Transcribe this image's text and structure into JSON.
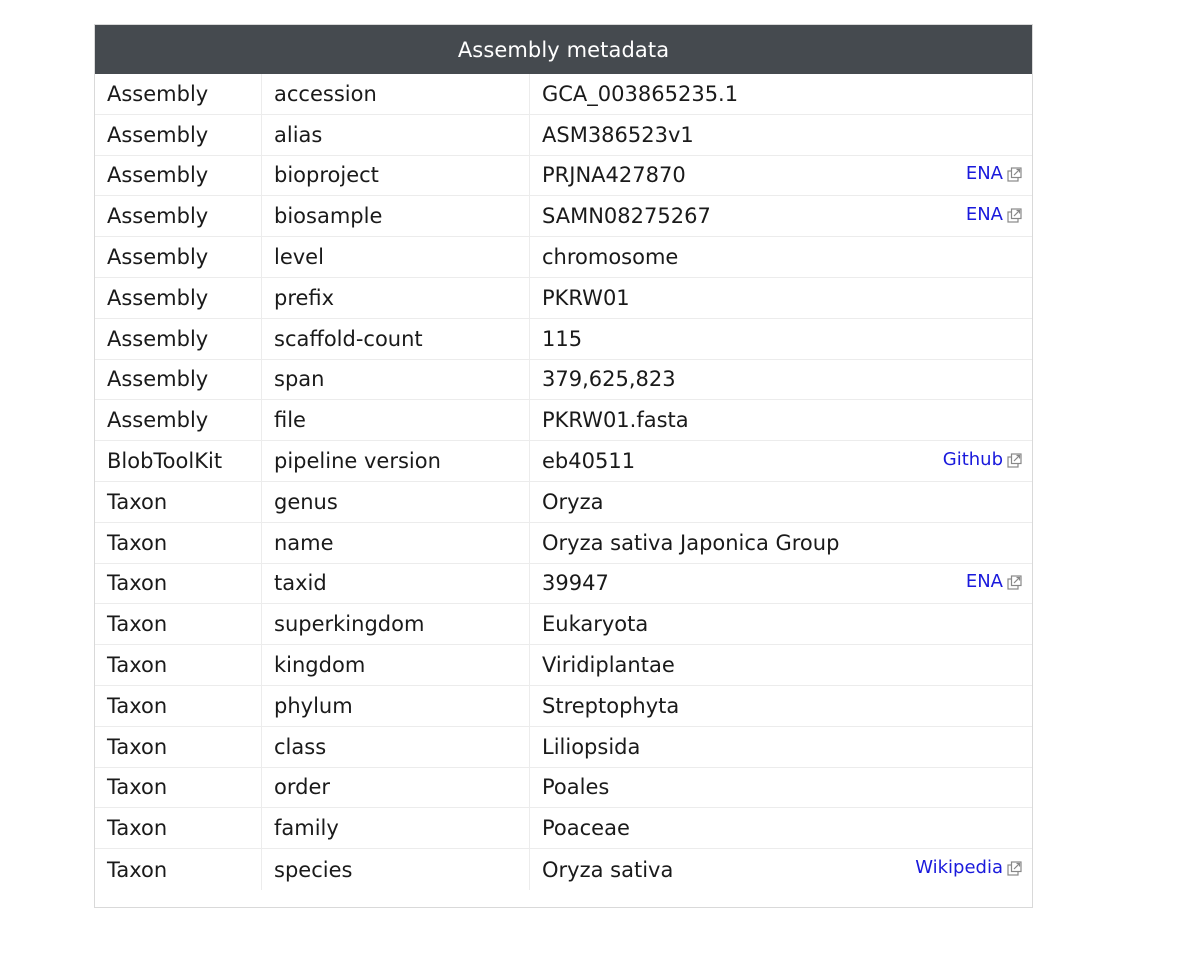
{
  "panel": {
    "title": "Assembly metadata"
  },
  "rows": [
    {
      "group": "Assembly",
      "key": "accession",
      "value": "GCA_003865235.1",
      "link": ""
    },
    {
      "group": "Assembly",
      "key": "alias",
      "value": "ASM386523v1",
      "link": ""
    },
    {
      "group": "Assembly",
      "key": "bioproject",
      "value": "PRJNA427870",
      "link": "ENA"
    },
    {
      "group": "Assembly",
      "key": "biosample",
      "value": "SAMN08275267",
      "link": "ENA"
    },
    {
      "group": "Assembly",
      "key": "level",
      "value": "chromosome",
      "link": ""
    },
    {
      "group": "Assembly",
      "key": "prefix",
      "value": "PKRW01",
      "link": ""
    },
    {
      "group": "Assembly",
      "key": "scaffold-count",
      "value": "115",
      "link": ""
    },
    {
      "group": "Assembly",
      "key": "span",
      "value": "379,625,823",
      "link": ""
    },
    {
      "group": "Assembly",
      "key": "file",
      "value": "PKRW01.fasta",
      "link": ""
    },
    {
      "group": "BlobToolKit",
      "key": "pipeline version",
      "value": "eb40511",
      "link": "Github"
    },
    {
      "group": "Taxon",
      "key": "genus",
      "value": "Oryza",
      "link": ""
    },
    {
      "group": "Taxon",
      "key": "name",
      "value": "Oryza sativa Japonica Group",
      "link": ""
    },
    {
      "group": "Taxon",
      "key": "taxid",
      "value": "39947",
      "link": "ENA"
    },
    {
      "group": "Taxon",
      "key": "superkingdom",
      "value": "Eukaryota",
      "link": ""
    },
    {
      "group": "Taxon",
      "key": "kingdom",
      "value": "Viridiplantae",
      "link": ""
    },
    {
      "group": "Taxon",
      "key": "phylum",
      "value": "Streptophyta",
      "link": ""
    },
    {
      "group": "Taxon",
      "key": "class",
      "value": "Liliopsida",
      "link": ""
    },
    {
      "group": "Taxon",
      "key": "order",
      "value": "Poales",
      "link": ""
    },
    {
      "group": "Taxon",
      "key": "family",
      "value": "Poaceae",
      "link": ""
    },
    {
      "group": "Taxon",
      "key": "species",
      "value": "Oryza sativa",
      "link": "Wikipedia"
    }
  ],
  "icons": {
    "external_link": "external-link-icon"
  },
  "colors": {
    "header_bg": "#454a4f",
    "link": "#1a1adc"
  }
}
